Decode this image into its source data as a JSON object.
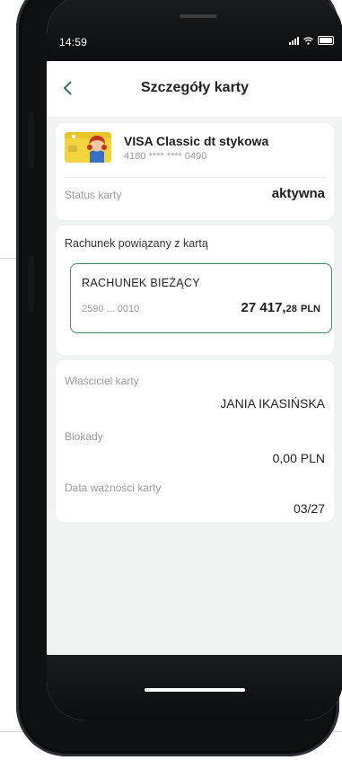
{
  "status_bar": {
    "time": "14:59"
  },
  "header": {
    "title": "Szczegóły karty"
  },
  "card": {
    "name": "VISA Classic dt stykowa",
    "number": "4180 **** **** 0490",
    "status_label": "Status karty",
    "status_value": "aktywna"
  },
  "account": {
    "section_title": "Rachunek powiązany z kartą",
    "name": "RACHUNEK BIEŻĄCY",
    "number": "2590 ... 0010",
    "balance_main": "27 417,",
    "balance_decimals": "28",
    "currency": "PLN"
  },
  "details": {
    "owner_label": "Właściciel karty",
    "owner_value": "JANIA IKASIŃSKA",
    "blocks_label": "Blokady",
    "blocks_value": "0,00 PLN",
    "expiry_label": "Data ważności karty",
    "expiry_value": "03/27"
  },
  "colors": {
    "accent_green": "#3f8f5f",
    "background": "#f1f3f2",
    "card_yellow": "#f3d43f"
  },
  "icons": {
    "back": "chevron-left-icon",
    "signal": "signal-icon",
    "wifi": "wifi-icon",
    "battery": "battery-icon"
  }
}
